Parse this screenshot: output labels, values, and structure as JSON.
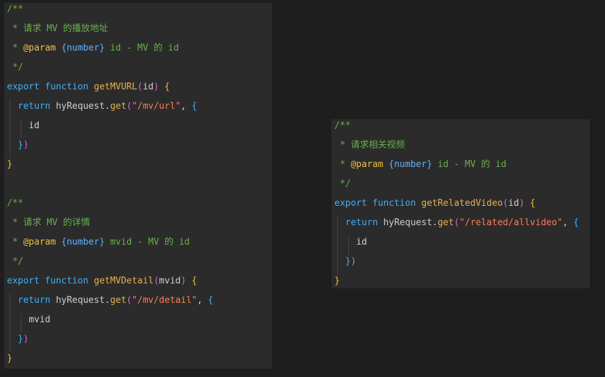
{
  "left_block": {
    "getMVURL": {
      "comment_open": "/**",
      "comment_desc": " * 请求 MV 的播放地址",
      "comment_param_star": " * ",
      "comment_param_tag": "@param",
      "comment_param_type": "{number}",
      "comment_param_rest": " id - MV 的 id",
      "comment_close": " */",
      "kw_export": "export",
      "kw_function": "function",
      "fn_name": "getMVURL",
      "param": "id",
      "kw_return": "return",
      "obj": "hyRequest",
      "method": "get",
      "url": "\"/mv/url\"",
      "body_field": "id",
      "close_paren": "})",
      "close_brace": "}"
    },
    "getMVDetail": {
      "comment_open": "/**",
      "comment_desc": " * 请求 MV 的详情",
      "comment_param_star": " * ",
      "comment_param_tag": "@param",
      "comment_param_type": "{number}",
      "comment_param_rest": " mvid - MV 的 id",
      "comment_close": " */",
      "kw_export": "export",
      "kw_function": "function",
      "fn_name": "getMVDetail",
      "param": "mvid",
      "kw_return": "return",
      "obj": "hyRequest",
      "method": "get",
      "url": "\"/mv/detail\"",
      "body_field": "mvid",
      "close_paren": "})",
      "close_brace": "}"
    }
  },
  "right_block": {
    "getRelatedVideo": {
      "comment_open": "/**",
      "comment_desc": " * 请求相关视频",
      "comment_param_star": " * ",
      "comment_param_tag": "@param",
      "comment_param_type": "{number}",
      "comment_param_rest": " id - MV 的 id",
      "comment_close": " */",
      "kw_export": "export",
      "kw_function": "function",
      "fn_name": "getRelatedVideo",
      "param": "id",
      "kw_return": "return",
      "obj": "hyRequest",
      "method": "get",
      "url": "\"/related/allvideo\"",
      "body_field": "id",
      "close_paren": "})",
      "close_brace": "}"
    }
  },
  "colors": {
    "background": "#1e1e1e",
    "panel": "#2b2b2b",
    "comment": "#6ab04c",
    "keyword": "#3fb0ff",
    "function": "#e6b050",
    "string": "#ff7b5a"
  }
}
